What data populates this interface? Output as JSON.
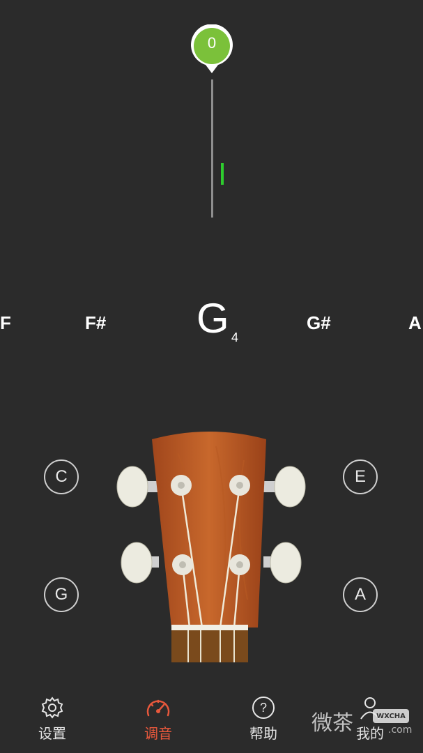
{
  "meter": {
    "cents_value": "0",
    "bubble_color": "#7bc13a",
    "needle_color": "#2ecc2e"
  },
  "notes": {
    "left_far": "F",
    "left": "F#",
    "current": "G",
    "current_octave": "4",
    "right": "G#",
    "right_far": "A"
  },
  "strings": {
    "top_left": "C",
    "top_right": "E",
    "bottom_left": "G",
    "bottom_right": "A"
  },
  "nav": {
    "settings": {
      "label": "设置",
      "icon": "gear-icon"
    },
    "tune": {
      "label": "调音",
      "icon": "gauge-icon",
      "active": true,
      "color": "#e8583c"
    },
    "help": {
      "label": "帮助",
      "icon": "question-icon"
    },
    "mine": {
      "label": "我的",
      "icon": "person-icon"
    }
  },
  "watermark": {
    "text": "微茶",
    "badge": "WXCHA",
    "sub": ".com"
  }
}
